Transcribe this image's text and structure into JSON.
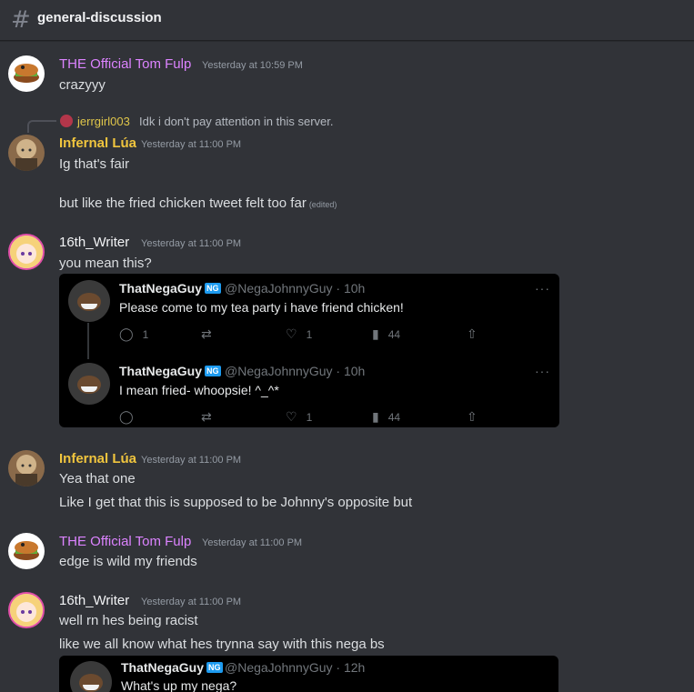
{
  "channel": {
    "name": "general-discussion"
  },
  "messages": [
    {
      "author": "THE Official Tom Fulp",
      "timestamp": "Yesterday at 10:59 PM",
      "lines": [
        "crazyyy"
      ]
    },
    {
      "reply_to": {
        "author": "jerrgirl003",
        "text": "Idk i don't pay attention in this server."
      },
      "author": "Infernal Lúa",
      "timestamp": "Yesterday at 11:00 PM",
      "lines": [
        "Ig that's fair",
        "but like the fried chicken tweet felt too far"
      ],
      "edited_label": "(edited)"
    },
    {
      "author": "16th_Writer",
      "timestamp": "Yesterday at 11:00 PM",
      "lines": [
        "you mean this?"
      ]
    },
    {
      "author": "Infernal Lúa",
      "timestamp": "Yesterday at 11:00 PM",
      "lines": [
        "Yea that one",
        "Like I get that this is supposed to be Johnny's opposite but"
      ]
    },
    {
      "author": "THE Official Tom Fulp",
      "timestamp": "Yesterday at 11:00 PM",
      "lines": [
        "edge is wild my friends"
      ]
    },
    {
      "author": "16th_Writer",
      "timestamp": "Yesterday at 11:00 PM",
      "lines": [
        "well rn hes being racist",
        "like we all know what hes trynna say with this nega bs"
      ]
    }
  ],
  "tweets": [
    {
      "name": "ThatNegaGuy",
      "badge": "NG",
      "handle": "@NegaJohnnyGuy · 10h",
      "text": "Please come to my tea party i have friend chicken!",
      "replies": "1",
      "likes": "1",
      "views": "44",
      "more": "···"
    },
    {
      "name": "ThatNegaGuy",
      "badge": "NG",
      "handle": "@NegaJohnnyGuy · 10h",
      "text": "I mean fried- whoopsie! ^_^*",
      "likes": "1",
      "views": "44",
      "more": "···"
    },
    {
      "name": "ThatNegaGuy",
      "badge": "NG",
      "handle": "@NegaJohnnyGuy · 12h",
      "text": "What's up my nega?",
      "more": "···"
    }
  ],
  "icons": {
    "channel": "hash-icon",
    "reply": "reply-icon",
    "retweet": "retweet-icon",
    "like": "heart-icon",
    "views": "views-icon",
    "share": "share-icon"
  }
}
